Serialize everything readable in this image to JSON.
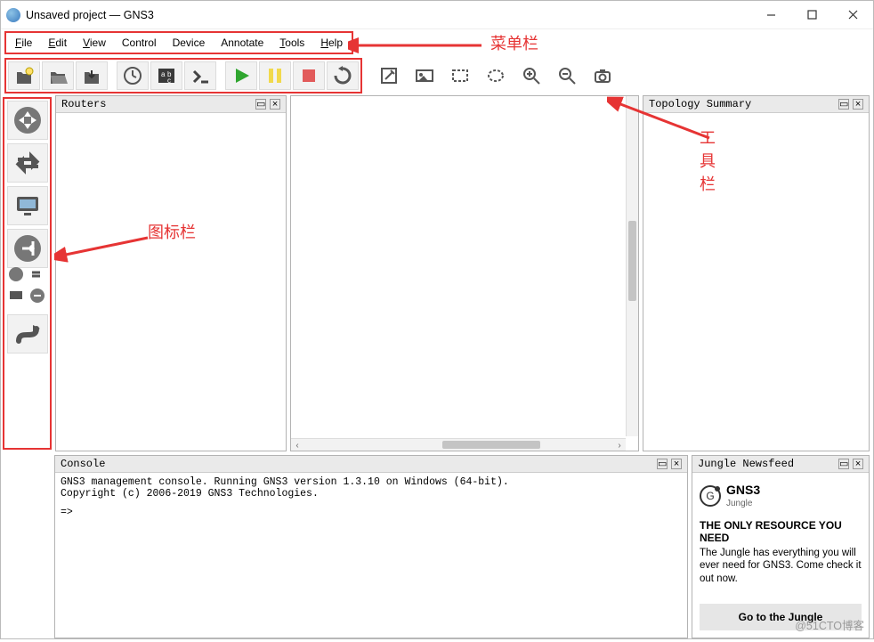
{
  "window": {
    "title": "Unsaved project — GNS3"
  },
  "menu": {
    "items": [
      {
        "label": "File",
        "underline": "F"
      },
      {
        "label": "Edit",
        "underline": "E"
      },
      {
        "label": "View",
        "underline": "V"
      },
      {
        "label": "Control",
        "underline": ""
      },
      {
        "label": "Device",
        "underline": ""
      },
      {
        "label": "Annotate",
        "underline": ""
      },
      {
        "label": "Tools",
        "underline": "T"
      },
      {
        "label": "Help",
        "underline": "H"
      }
    ]
  },
  "toolbar_primary": [
    "new-project",
    "open-project",
    "save-project",
    "snapshot",
    "show-port-names",
    "console-all",
    "start",
    "pause",
    "stop",
    "reload"
  ],
  "toolbar_secondary": [
    "add-note",
    "insert-image",
    "draw-rectangle",
    "draw-ellipse",
    "zoom-in",
    "zoom-out",
    "screenshot"
  ],
  "device_sidebar": [
    "routers",
    "switches",
    "end-devices",
    "security-devices",
    "all-devices",
    "add-link"
  ],
  "panels": {
    "routers_title": "Routers",
    "topology_title": "Topology Summary",
    "console_title": "Console",
    "newsfeed_title": "Jungle Newsfeed"
  },
  "console": {
    "line1": "GNS3 management console. Running GNS3 version 1.3.10 on Windows (64-bit).",
    "line2": "Copyright (c) 2006-2019 GNS3 Technologies.",
    "prompt": "=>"
  },
  "newsfeed": {
    "brand_line1": "GNS3",
    "brand_line2": "Jungle",
    "headline": "THE ONLY RESOURCE YOU NEED",
    "desc": "The Jungle has everything you will ever need for GNS3. Come check it out now.",
    "button": "Go to the Jungle"
  },
  "annotations": {
    "menubar_label": "菜单栏",
    "toolbar_label": "工具栏",
    "iconbar_label": "图标栏"
  },
  "watermark": "@51CTO博客"
}
